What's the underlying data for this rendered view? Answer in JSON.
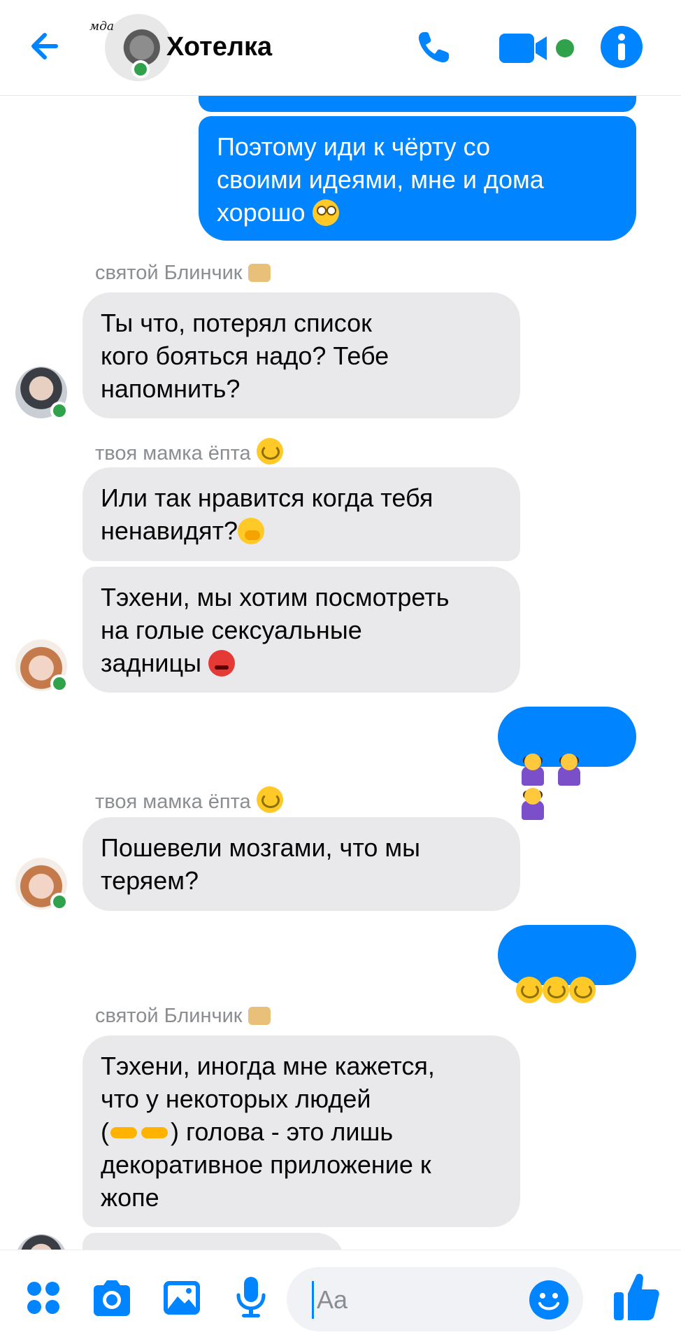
{
  "header": {
    "title": "Хотелка",
    "avatar_text": "мда",
    "icons": [
      "back-arrow-icon",
      "phone-icon",
      "video-camera-icon",
      "info-icon"
    ],
    "accent": "#0084ff",
    "online": "#31a24c"
  },
  "messages": {
    "m0": "Поэтому иди к чёрту со\nсвоими идеями, мне и дома\nхорошо",
    "s1": "святой Блинчик",
    "m1": "Ты что, потерял список\nкого бояться надо? Тебе\nнапомнить?",
    "s2": "твоя мамка ёпта",
    "m2": "Или так нравится когда тебя\nненавидят?",
    "m3": "Тэхени, мы хотим посмотреть\nна голые сексуальные\nзадницы",
    "s3": "твоя мамка ёпта",
    "m5": "Пошевели мозгами, что мы\nтеряем?",
    "s4": "святой Блинчик",
    "m7a": "Тэхени, иногда мне кажется,\nчто у некоторых людей\n(",
    "m7b": ") голова - это лишь\nдекоративное приложение к\nжопе"
  },
  "composer": {
    "placeholder": "Aa",
    "value": "",
    "icons": [
      "apps-grid-icon",
      "camera-icon",
      "image-icon",
      "microphone-icon",
      "emoji-icon",
      "thumbs-up-icon"
    ]
  }
}
